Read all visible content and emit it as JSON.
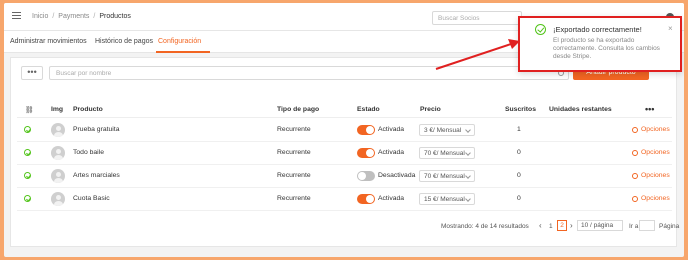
{
  "breadcrumb": [
    "Inicio",
    "Payments",
    "Productos"
  ],
  "top_search_placeholder": "Buscar Socios",
  "tabs": [
    "Administrar movimientos",
    "Histórico de pagos",
    "Configuración"
  ],
  "search_placeholder": "Buscar por nombre",
  "add_button": "Añadir producto",
  "more_label": "•••",
  "columns": {
    "img": "Img",
    "product": "Producto",
    "payment_type": "Tipo de pago",
    "status": "Estado",
    "price": "Precio",
    "subscribers": "Suscritos",
    "remaining": "Unidades restantes",
    "more": "•••"
  },
  "rows": [
    {
      "product": "Prueba gratuita",
      "payment_type": "Recurrente",
      "status": "Activada",
      "active": true,
      "price": "3 €/ Mensual",
      "subscribers": "1",
      "options": "Opciones"
    },
    {
      "product": "Todo baile",
      "payment_type": "Recurrente",
      "status": "Activada",
      "active": true,
      "price": "70 €/ Mensual",
      "subscribers": "0",
      "options": "Opciones"
    },
    {
      "product": "Artes marciales",
      "payment_type": "Recurrente",
      "status": "Desactivada",
      "active": false,
      "price": "70 €/ Mensual",
      "subscribers": "0",
      "options": "Opciones"
    },
    {
      "product": "Cuota Basic",
      "payment_type": "Recurrente",
      "status": "Activada",
      "active": true,
      "price": "15 €/ Mensual",
      "subscribers": "0",
      "options": "Opciones"
    }
  ],
  "pagination": {
    "summary": "Mostrando: 4 de 14 resultados",
    "prev": "‹",
    "page1": "1",
    "page2": "2",
    "next": "›",
    "per_page": "10 / página",
    "goto": "Ir a",
    "page_word": "Página"
  },
  "toast": {
    "title": "¡Exportado correctamente!",
    "message": "El producto se ha exportado correctamente. Consulta los cambios desde Stripe.",
    "close": "×"
  },
  "colors": {
    "accent": "#f26522",
    "success": "#52c41a",
    "annotation": "#e02020"
  }
}
